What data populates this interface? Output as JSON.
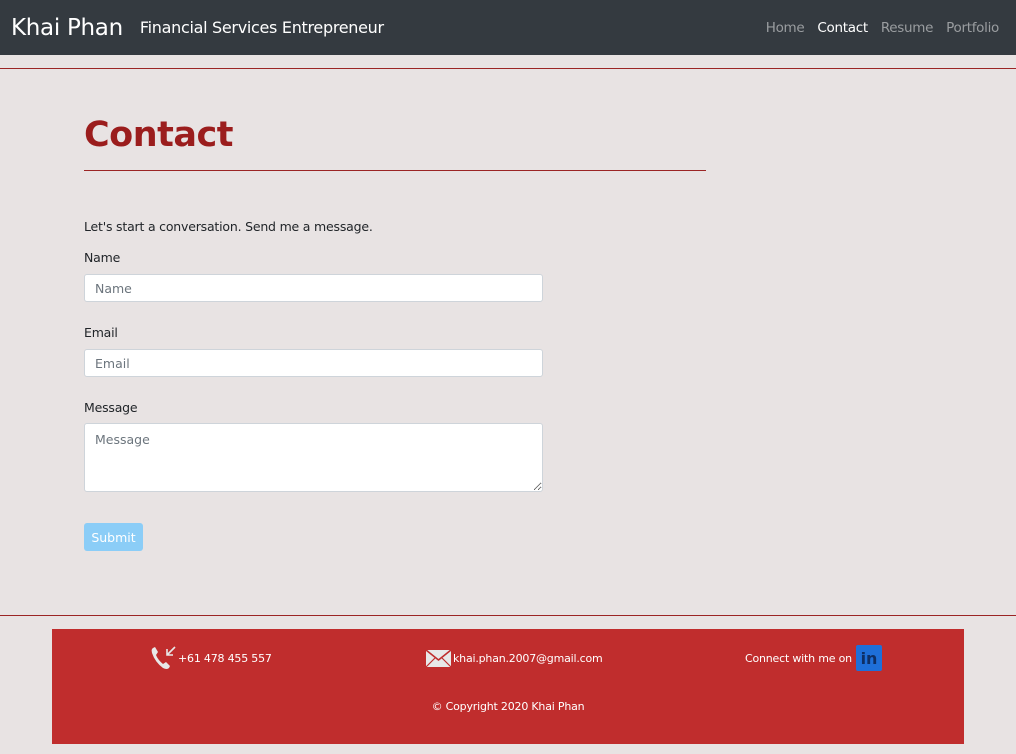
{
  "header": {
    "brand": "Khai Phan",
    "subtitle": "Financial Services Entrepreneur",
    "nav": [
      "Home",
      "Contact",
      "Resume",
      "Portfolio"
    ],
    "active_nav": "Contact"
  },
  "main": {
    "title": "Contact",
    "intro": "Let's start a conversation. Send me a message.",
    "form": {
      "name_label": "Name",
      "name_placeholder": "Name",
      "email_label": "Email",
      "email_placeholder": "Email",
      "message_label": "Message",
      "message_placeholder": "Message",
      "submit_label": "Submit"
    }
  },
  "footer": {
    "phone": "+61 478 455 557",
    "email": "khai.phan.2007@gmail.com",
    "linkedin_text": "Connect with me on",
    "copyright": "© Copyright 2020 Khai Phan"
  },
  "colors": {
    "navbar": "#343a40",
    "accent": "#9b1d1d",
    "footer": "#c02d2d",
    "submit": "#8bcdf7"
  },
  "icons": [
    "phone-icon",
    "mail-icon",
    "linkedin-icon"
  ]
}
